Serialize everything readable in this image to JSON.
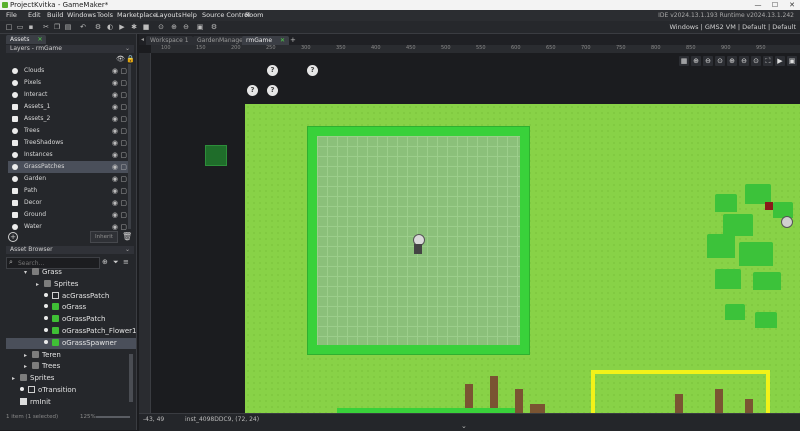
{
  "window": {
    "title": "ProjectKvitka - GameMaker*",
    "minimize": "—",
    "maximize": "☐",
    "close": "✕"
  },
  "menu": {
    "items": [
      "File",
      "Edit",
      "Build",
      "Windows",
      "Tools",
      "Marketplace",
      "Layouts",
      "Help",
      "Source Control",
      "Room"
    ],
    "ide_version": "IDE v2024.13.1.193  Runtime v2024.13.1.242"
  },
  "toolbar": {
    "target": "Windows | GMS2 VM | Default | Default"
  },
  "left_panel": {
    "tab_label": "Assets",
    "layers_title": "Layers - rmGame",
    "layers": [
      {
        "name": "Clouds",
        "icon": "circle"
      },
      {
        "name": "Pixels",
        "icon": "circle"
      },
      {
        "name": "Interact",
        "icon": "circle"
      },
      {
        "name": "Assets_1",
        "icon": "square"
      },
      {
        "name": "Assets_2",
        "icon": "square"
      },
      {
        "name": "Trees",
        "icon": "circle"
      },
      {
        "name": "TreeShadows",
        "icon": "square"
      },
      {
        "name": "Instances",
        "icon": "circle"
      },
      {
        "name": "GrassPatches",
        "icon": "circle",
        "selected": true
      },
      {
        "name": "Garden",
        "icon": "circle"
      },
      {
        "name": "Path",
        "icon": "square"
      },
      {
        "name": "Decor",
        "icon": "square"
      },
      {
        "name": "Ground",
        "icon": "square"
      },
      {
        "name": "Water",
        "icon": "circle"
      }
    ],
    "inherit_label": "Inherit",
    "asset_browser_title": "Asset Browser",
    "search_placeholder": "Search...",
    "tree": [
      {
        "label": "Grass",
        "type": "folder",
        "indent": 1,
        "arrow": "▾"
      },
      {
        "label": "Sprites",
        "type": "folder",
        "indent": 2,
        "arrow": "▸"
      },
      {
        "label": "acGrassPatch",
        "type": "sprite",
        "indent": 2,
        "arrow": ""
      },
      {
        "label": "oGrass",
        "type": "object",
        "indent": 2,
        "arrow": ""
      },
      {
        "label": "oGrassPatch",
        "type": "object",
        "indent": 2,
        "arrow": ""
      },
      {
        "label": "oGrassPatch_Flower1",
        "type": "object",
        "indent": 2,
        "arrow": ""
      },
      {
        "label": "oGrassSpawner",
        "type": "object",
        "indent": 2,
        "arrow": "",
        "selected": true
      },
      {
        "label": "Teren",
        "type": "folder",
        "indent": 1,
        "arrow": "▸"
      },
      {
        "label": "Trees",
        "type": "folder",
        "indent": 1,
        "arrow": "▸"
      },
      {
        "label": "Sprites",
        "type": "folder",
        "indent": 0,
        "arrow": "▸"
      },
      {
        "label": "oTransition",
        "type": "object-plain",
        "indent": 0,
        "arrow": ""
      },
      {
        "label": "rmInit",
        "type": "room",
        "indent": 0,
        "arrow": ""
      }
    ],
    "status_left": "1 item (1 selected)",
    "zoom": "125%"
  },
  "editor": {
    "tabs": [
      "Workspace 1",
      "GardenManager",
      "rmGame"
    ],
    "active_tab": "rmGame",
    "ruler_ticks": [
      "100",
      "150",
      "200",
      "250",
      "300",
      "350",
      "400",
      "450",
      "500",
      "550",
      "600",
      "650",
      "700",
      "750",
      "800",
      "850",
      "900",
      "950"
    ],
    "status_coords": "-43, 49",
    "status_instance": "inst_4098DDC9, (72, 24)",
    "view_buttons": [
      "▦",
      "⊕",
      "⊖",
      "⊙",
      "⊕",
      "⊖",
      "⊙",
      "⛶",
      "▶",
      "▣"
    ]
  },
  "colors": {
    "accent_green": "#3fbf35",
    "room_grass": "#88d247",
    "selection_yellow": "#f2f219",
    "zone_green": "#39d13a"
  }
}
